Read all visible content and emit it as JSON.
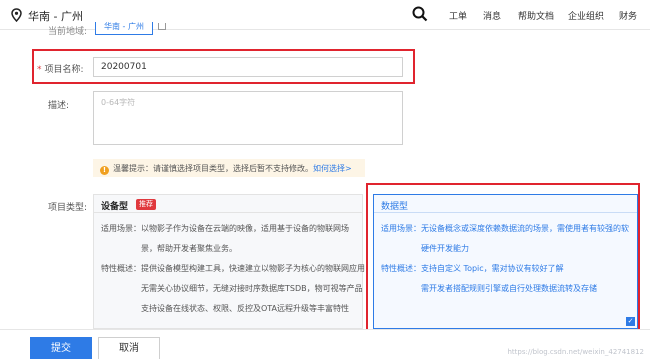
{
  "header": {
    "region": "华南 - 广州",
    "nav": [
      "工单",
      "消息",
      "帮助文档",
      "企业组织",
      "财务"
    ]
  },
  "form": {
    "region_label": "当前地域:",
    "region_value": "华南 - 广州",
    "project_name_label": "项目名称:",
    "required_mark": "*",
    "project_name_value": "20200701",
    "desc_label": "描述:",
    "desc_placeholder": "0-64字符",
    "tip_icon": "!",
    "tip_text": "温馨提示：请谨慎选择项目类型，选择后暂不支持修改。",
    "tip_link": "如何选择>",
    "type_label": "项目类型:"
  },
  "cards": {
    "device": {
      "title": "设备型",
      "badge": "推荐",
      "lines": [
        "适用场景：以物影子作为设备在云端的映像，适用基于设备的物联网场",
        "景，帮助开发者聚焦业务。",
        "特性概述：提供设备模型构建工具，快速建立以物影子为核心的物联网应用",
        "无需关心协议细节，无缝对接时序数据库TSDB，物可视等产品",
        "支持设备在线状态、权限、反控及OTA远程升级等丰富特性"
      ]
    },
    "data": {
      "title": "数据型",
      "lines": [
        "适用场景：无设备概念或深度依赖数据流的场景，需使用者有较强的软",
        "硬件开发能力",
        "特性概述：支持自定义 Topic，需对协议有较好了解",
        "需开发者搭配规则引擎或自行处理数据流转及存储"
      ],
      "check": "✓"
    }
  },
  "footer": {
    "submit": "提交",
    "cancel": "取消",
    "watermark": "https://blog.csdn.net/weixin_42741812"
  },
  "colors": {
    "accent": "#2e7be6",
    "highlight": "#e0242e",
    "danger": "#e0393e"
  }
}
